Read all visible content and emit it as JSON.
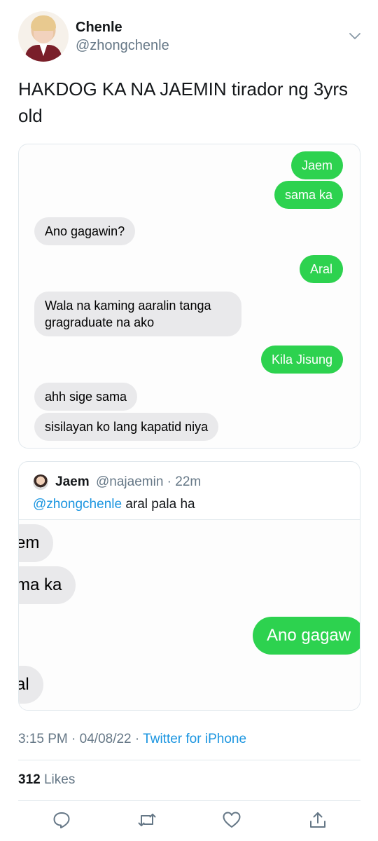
{
  "author": {
    "name": "Chenle",
    "handle": "@zhongchenle"
  },
  "tweet": {
    "text": "HAKDOG KA NA JAEMIN tirador ng 3yrs old"
  },
  "screenshot": {
    "messages": [
      {
        "side": "out",
        "text": "Jaem"
      },
      {
        "side": "out",
        "text": "sama ka"
      },
      {
        "side": "in",
        "text": "Ano gagawin?"
      },
      {
        "side": "out",
        "text": "Aral"
      },
      {
        "side": "in",
        "text": "Wala na kaming aaralin tanga gragraduate na ako"
      },
      {
        "side": "out",
        "text": "Kila Jisung"
      },
      {
        "side": "in",
        "text": "ahh sige sama"
      },
      {
        "side": "in",
        "text": "sisilayan ko lang kapatid niya"
      }
    ]
  },
  "quote": {
    "name": "Jaem",
    "handle": "@najaemin",
    "time": "22m",
    "mention": "@zhongchenle",
    "text": "aral pala ha",
    "media_bubbles": [
      {
        "side": "in",
        "text": "em"
      },
      {
        "side": "in",
        "text": "ma ka"
      },
      {
        "side": "out",
        "text": "Ano gagaw"
      },
      {
        "side": "in",
        "text": "al"
      }
    ]
  },
  "meta": {
    "time": "3:15 PM",
    "date": "04/08/22",
    "source": "Twitter for iPhone"
  },
  "stats": {
    "likes_count": "312",
    "likes_label": "Likes"
  },
  "actions": [
    "reply-icon",
    "retweet-icon",
    "like-icon",
    "share-icon"
  ],
  "colors": {
    "imessage_green": "#2dd24f",
    "incoming_gray": "#e9e9eb",
    "link_blue": "#1b95e0",
    "secondary_text": "#657786"
  }
}
